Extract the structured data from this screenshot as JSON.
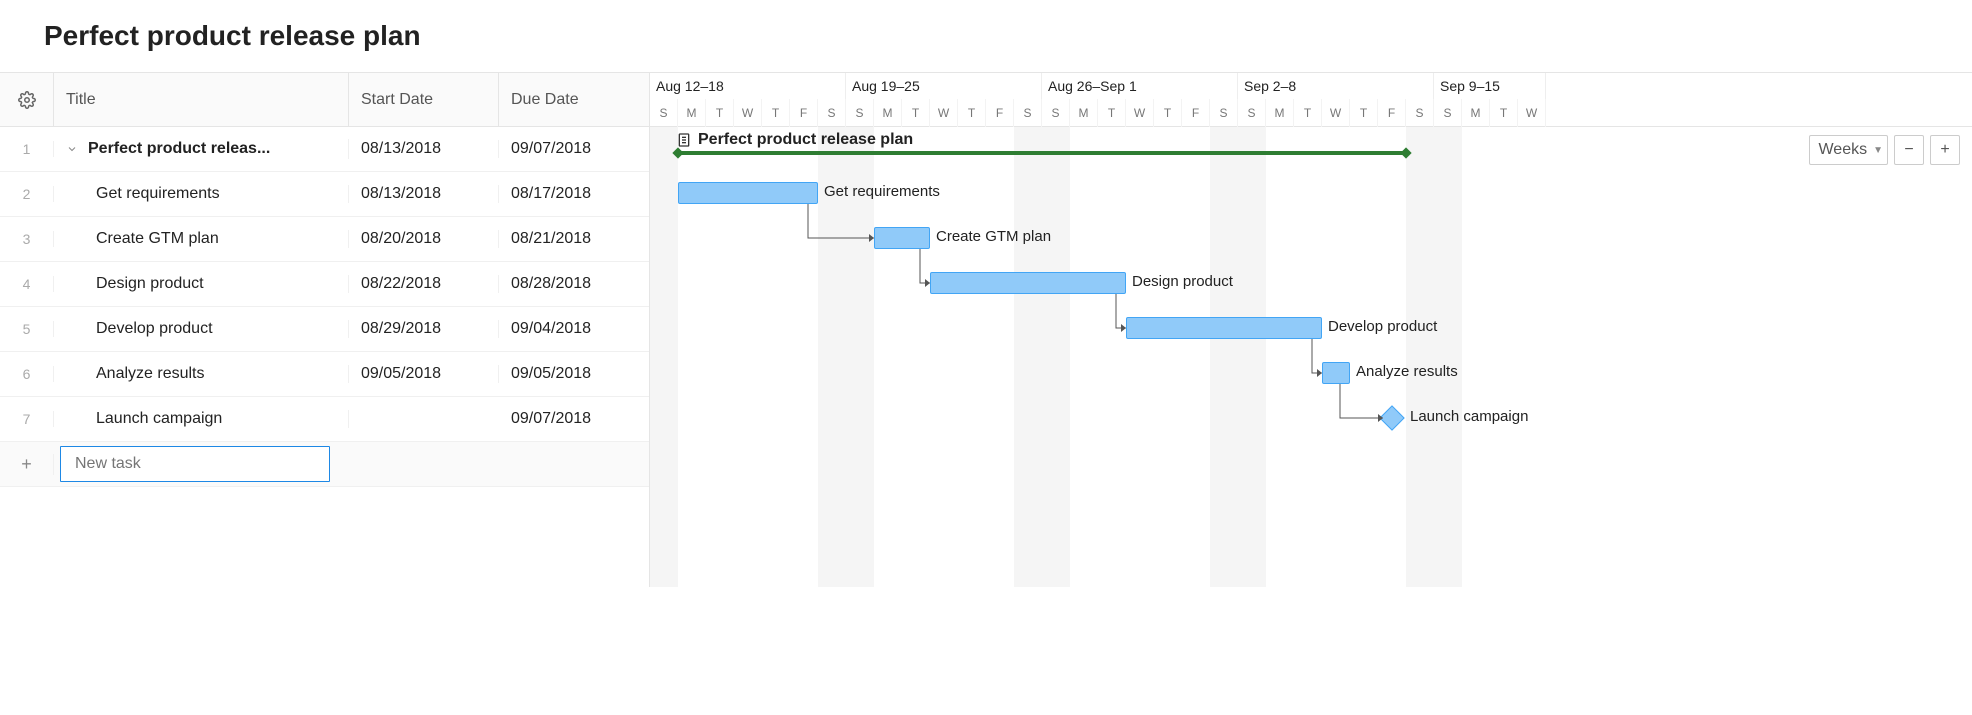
{
  "title": "Perfect product release plan",
  "columns": {
    "title": "Title",
    "start": "Start Date",
    "due": "Due Date"
  },
  "rows": [
    {
      "idx": "1",
      "title": "Perfect product releas...",
      "start": "08/13/2018",
      "due": "09/07/2018",
      "parent": true
    },
    {
      "idx": "2",
      "title": "Get requirements",
      "start": "08/13/2018",
      "due": "08/17/2018"
    },
    {
      "idx": "3",
      "title": "Create GTM plan",
      "start": "08/20/2018",
      "due": "08/21/2018"
    },
    {
      "idx": "4",
      "title": "Design product",
      "start": "08/22/2018",
      "due": "08/28/2018"
    },
    {
      "idx": "5",
      "title": "Develop product",
      "start": "08/29/2018",
      "due": "09/04/2018"
    },
    {
      "idx": "6",
      "title": "Analyze results",
      "start": "09/05/2018",
      "due": "09/05/2018"
    },
    {
      "idx": "7",
      "title": "Launch campaign",
      "start": "",
      "due": "09/07/2018"
    }
  ],
  "new_task_placeholder": "New task",
  "timeline": {
    "weeks": [
      {
        "label": "Aug 12–18",
        "days": [
          "S",
          "M",
          "T",
          "W",
          "T",
          "F",
          "S"
        ]
      },
      {
        "label": "Aug 19–25",
        "days": [
          "S",
          "M",
          "T",
          "W",
          "T",
          "F",
          "S"
        ]
      },
      {
        "label": "Aug 26–Sep 1",
        "days": [
          "S",
          "M",
          "T",
          "W",
          "T",
          "F",
          "S"
        ]
      },
      {
        "label": "Sep 2–8",
        "days": [
          "S",
          "M",
          "T",
          "W",
          "T",
          "F",
          "S"
        ]
      },
      {
        "label": "Sep 9–15",
        "days": [
          "S",
          "M",
          "T",
          "W"
        ]
      }
    ],
    "scale_label": "Weeks",
    "summary_label": "Perfect product release plan"
  },
  "chart_data": {
    "type": "gantt",
    "unit": "day",
    "start": "2018-08-12",
    "end": "2018-09-15",
    "tasks": [
      {
        "name": "Perfect product release plan",
        "start": "2018-08-13",
        "end": "2018-09-07",
        "kind": "summary"
      },
      {
        "name": "Get requirements",
        "start": "2018-08-13",
        "end": "2018-08-17",
        "kind": "task"
      },
      {
        "name": "Create GTM plan",
        "start": "2018-08-20",
        "end": "2018-08-21",
        "kind": "task"
      },
      {
        "name": "Design product",
        "start": "2018-08-22",
        "end": "2018-08-28",
        "kind": "task"
      },
      {
        "name": "Develop product",
        "start": "2018-08-29",
        "end": "2018-09-04",
        "kind": "task"
      },
      {
        "name": "Analyze results",
        "start": "2018-09-05",
        "end": "2018-09-05",
        "kind": "task"
      },
      {
        "name": "Launch campaign",
        "start": "2018-09-07",
        "end": "2018-09-07",
        "kind": "milestone"
      }
    ],
    "dependencies": [
      [
        "Get requirements",
        "Create GTM plan"
      ],
      [
        "Create GTM plan",
        "Design product"
      ],
      [
        "Design product",
        "Develop product"
      ],
      [
        "Develop product",
        "Analyze results"
      ],
      [
        "Analyze results",
        "Launch campaign"
      ]
    ]
  }
}
